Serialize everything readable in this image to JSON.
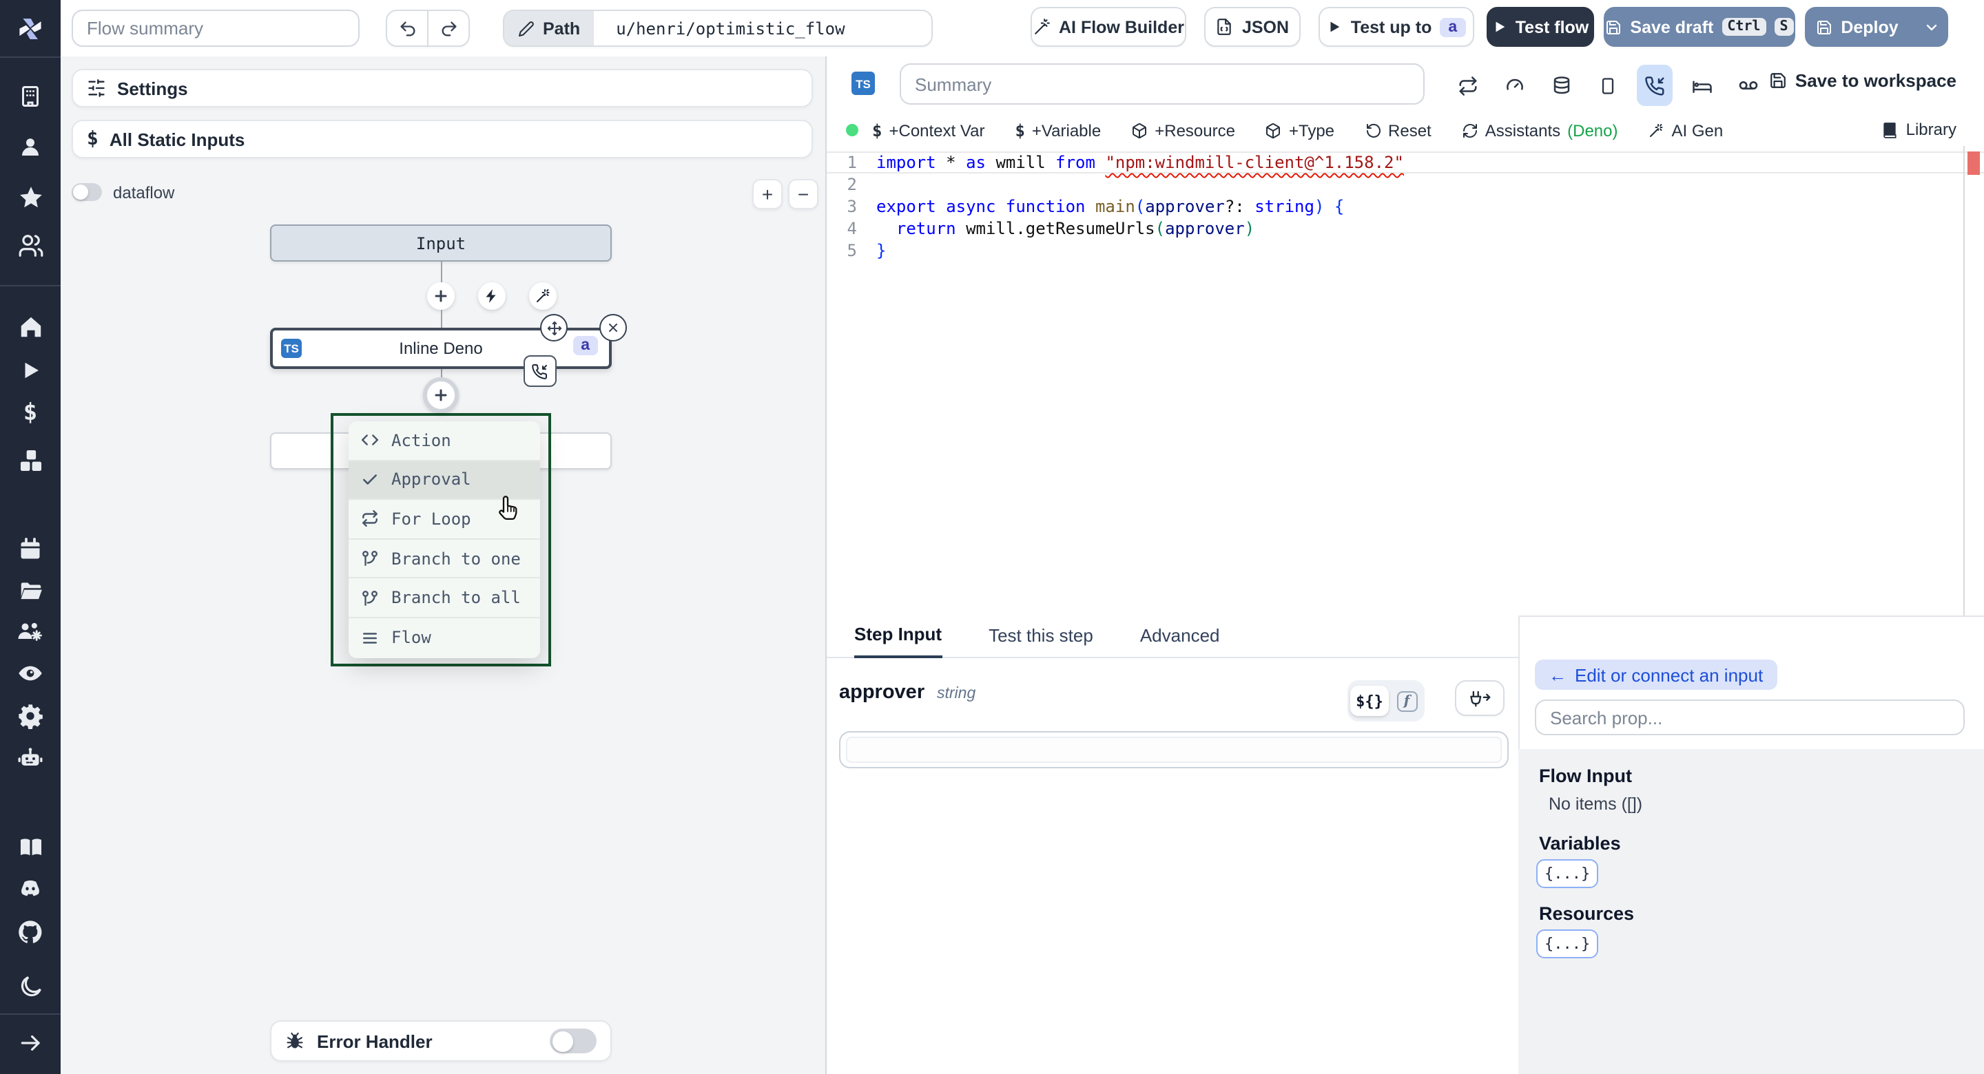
{
  "topbar": {
    "flow_summary_placeholder": "Flow summary",
    "path_label": "Path",
    "path_value": "u/henri/optimistic_flow",
    "ai_flow_builder": "AI Flow Builder",
    "json_button": "JSON",
    "test_up_to": "Test up to",
    "test_up_to_badge": "a",
    "test_flow": "Test flow",
    "save_draft": "Save draft",
    "save_draft_kbd": [
      "Ctrl",
      "S"
    ],
    "deploy": "Deploy"
  },
  "left_panel": {
    "settings": "Settings",
    "all_static_inputs": "All Static Inputs",
    "dataflow_label": "dataflow",
    "zoom_in": "+",
    "zoom_out": "−",
    "input_node_label": "Input",
    "step_node": {
      "lang_badge": "TS",
      "label": "Inline Deno",
      "id_badge": "a"
    },
    "insert_menu": [
      "Action",
      "Approval",
      "For Loop",
      "Branch to one",
      "Branch to all",
      "Flow"
    ],
    "error_handler": "Error Handler"
  },
  "editor": {
    "lang_badge": "TS",
    "summary_placeholder": "Summary",
    "save_to_workspace": "Save to workspace",
    "toolbar": {
      "context_var": "+Context Var",
      "variable": "+Variable",
      "resource": "+Resource",
      "type": "+Type",
      "reset": "Reset",
      "assistants": "Assistants",
      "assistants_lang": "(Deno)",
      "ai_gen": "AI Gen",
      "library": "Library"
    },
    "code": {
      "lines": [
        {
          "n": "1",
          "current": true,
          "segs": [
            [
              "import",
              "kw"
            ],
            [
              " * ",
              "pl"
            ],
            [
              "as",
              "kw"
            ],
            [
              " wmill ",
              "pl"
            ],
            [
              "from",
              "kw"
            ],
            [
              " ",
              "pl"
            ],
            [
              "\"npm:windmill-client@^1.158.2\"",
              "str"
            ]
          ]
        },
        {
          "n": "2",
          "segs": []
        },
        {
          "n": "3",
          "segs": [
            [
              "export",
              "kw"
            ],
            [
              " ",
              "pl"
            ],
            [
              "async",
              "kw"
            ],
            [
              " ",
              "pl"
            ],
            [
              "function",
              "kw"
            ],
            [
              " ",
              "pl"
            ],
            [
              "main",
              "fn"
            ],
            [
              "(",
              "b1"
            ],
            [
              "approver",
              "pm"
            ],
            [
              "?: ",
              "pl"
            ],
            [
              "string",
              "kw"
            ],
            [
              ") {",
              "b1"
            ]
          ]
        },
        {
          "n": "4",
          "segs": [
            [
              "  ",
              "pl"
            ],
            [
              "return",
              "kw"
            ],
            [
              " wmill.getResumeUrls",
              "pl"
            ],
            [
              "(",
              "b2"
            ],
            [
              "approver",
              "pm"
            ],
            [
              ")",
              "b2"
            ]
          ]
        },
        {
          "n": "5",
          "segs": [
            [
              "}",
              "b1"
            ]
          ]
        }
      ]
    }
  },
  "bottom": {
    "tabs": [
      "Step Input",
      "Test this step",
      "Advanced"
    ],
    "active_tab": "Step Input",
    "field_name": "approver",
    "field_type": "string",
    "expr_toggle": "${}",
    "fn_toggle": "f",
    "connect_panel": {
      "back_arrow": "←",
      "edit_button": "Edit or connect an input",
      "search_placeholder": "Search prop...",
      "flow_input_title": "Flow Input",
      "flow_input_empty": "No items ([])",
      "variables_title": "Variables",
      "variables_chip": "{...}",
      "resources_title": "Resources",
      "resources_chip": "{...}"
    }
  },
  "colors": {
    "steel_blue_button": "#6e87aa",
    "dark_button": "#2b3444",
    "ts_badge_blue": "#3178c6",
    "id_badge_bg": "#dbe0fb",
    "id_badge_text": "#3b3aa8",
    "status_dot_green": "#4ade80",
    "deno_green": "#16a34a",
    "insert_menu_border_green": "#14532d",
    "error_marker_red": "#e9706a",
    "sidebar_bg": "#212837"
  }
}
